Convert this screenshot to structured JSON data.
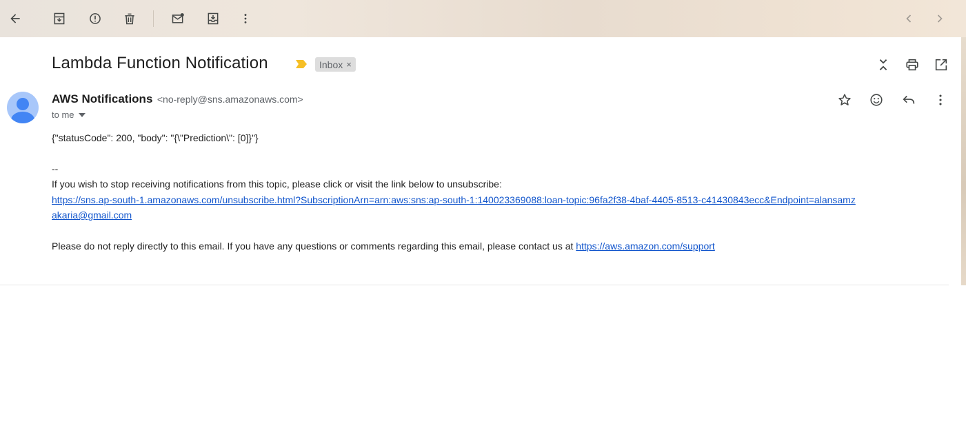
{
  "toolbar": {
    "icons": [
      "back-arrow-icon",
      "archive-icon",
      "report-spam-icon",
      "delete-icon",
      "mark-unread-icon",
      "move-to-icon",
      "more-vert-icon",
      "chevron-left-icon",
      "chevron-right-icon"
    ]
  },
  "message": {
    "subject": "Lambda Function Notification",
    "label": "Inbox",
    "label_remove": "×",
    "sender_name": "AWS Notifications",
    "sender_email": "<no-reply@sns.amazonaws.com>",
    "to_line": "to me",
    "body": {
      "json_line": "{\"statusCode\": 200, \"body\": \"{\\\"Prediction\\\": [0]}\"}",
      "separator": "--",
      "unsubscribe_text": "If you wish to stop receiving notifications from this topic, please click or visit the link below to unsubscribe:",
      "unsubscribe_link_line1": "https://sns.ap-south-1.amazonaws.com/unsubscribe.html?SubscriptionArn=arn:aws:sns:ap-south-1:140023369088:loan-topic:96fa2f38-4baf-4405-8513-c41430843ecc&Endpoint=alansamz",
      "unsubscribe_link_line2": "akaria@gmail.com",
      "footer_text": "Please do not reply directly to this email. If you have any questions or comments regarding this email, please contact us at ",
      "support_link": "https://aws.amazon.com/support"
    }
  },
  "colors": {
    "link": "#1155cc",
    "important_marker": "#f6bf26",
    "avatar_bg": "#a8c7fa",
    "avatar_fg": "#4285f4"
  }
}
